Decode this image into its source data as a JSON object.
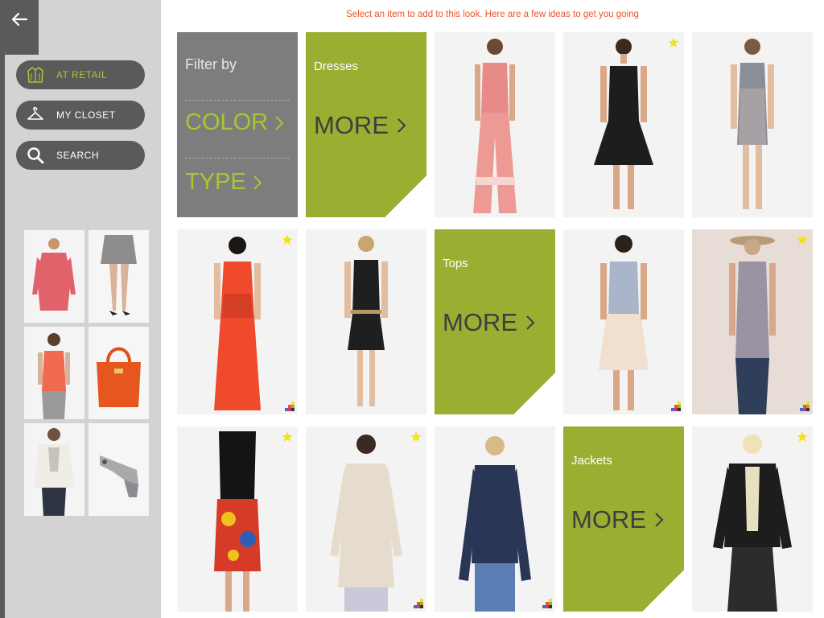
{
  "hint": "Select an item to add to this look. Here are a few ideas to get you going",
  "sidebar": {
    "buttons": [
      {
        "label": "AT RETAIL",
        "icon": "jacket-icon",
        "active": true
      },
      {
        "label": "MY CLOSET",
        "icon": "hanger-icon",
        "active": false
      },
      {
        "label": "SEARCH",
        "icon": "search-icon",
        "active": false
      }
    ],
    "closet_items": [
      "pink-jacket",
      "gray-skirt",
      "coral-tank",
      "orange-handbag",
      "white-blouse",
      "silver-wedge-shoe"
    ]
  },
  "filter": {
    "title": "Filter by",
    "options": [
      "COLOR",
      "TYPE"
    ]
  },
  "categories": {
    "dresses": {
      "label": "Dresses",
      "more": "MORE"
    },
    "tops": {
      "label": "Tops",
      "more": "MORE"
    },
    "jackets": {
      "label": "Jackets",
      "more": "MORE"
    }
  },
  "colors": {
    "accent_green": "#9aae32",
    "filter_gray": "#7d7d7d",
    "hint_orange": "#e8572a",
    "star_yellow": "#f2e21c"
  }
}
